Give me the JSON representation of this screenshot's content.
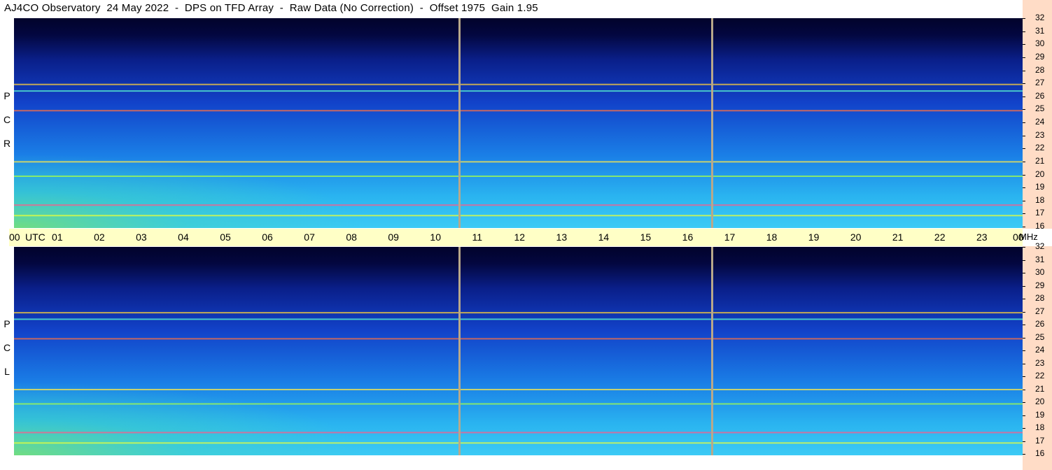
{
  "title": "AJ4CO Observatory  24 May 2022  -  DPS on TFD Array  -  Raw Data (No Correction)  -  Offset 1975  Gain 1.95",
  "chart_data": {
    "type": "heatmap",
    "panels": [
      {
        "label_letters": [
          "R",
          "C",
          "P"
        ]
      },
      {
        "label_letters": [
          "L",
          "C",
          "P"
        ]
      }
    ],
    "x_axis": {
      "ticks": [
        "00",
        "01",
        "02",
        "03",
        "04",
        "05",
        "06",
        "07",
        "08",
        "09",
        "10",
        "11",
        "12",
        "13",
        "14",
        "15",
        "16",
        "17",
        "18",
        "19",
        "20",
        "21",
        "22",
        "23",
        "00"
      ],
      "unit_label": "UTC",
      "range_hours": [
        0,
        24
      ]
    },
    "y_axis": {
      "ticks": [
        "16",
        "17",
        "18",
        "19",
        "20",
        "21",
        "22",
        "23",
        "24",
        "25",
        "26",
        "27",
        "28",
        "29",
        "30",
        "31",
        "32"
      ],
      "unit_label": "MHz",
      "range_mhz": [
        16,
        32
      ]
    },
    "data_gaps_utc_hours": [
      10.6,
      16.6
    ],
    "strong_bands_mhz": [
      17.0,
      17.8,
      20.0,
      21.1,
      25.0,
      26.5,
      27.0
    ],
    "colors": {
      "time_bar": "#ffffc6",
      "freq_column": "#ffdcc6",
      "gap_line": "#b8a88a",
      "low_intensity": "#03053a",
      "high_intensity": "#4ad9ff"
    }
  }
}
